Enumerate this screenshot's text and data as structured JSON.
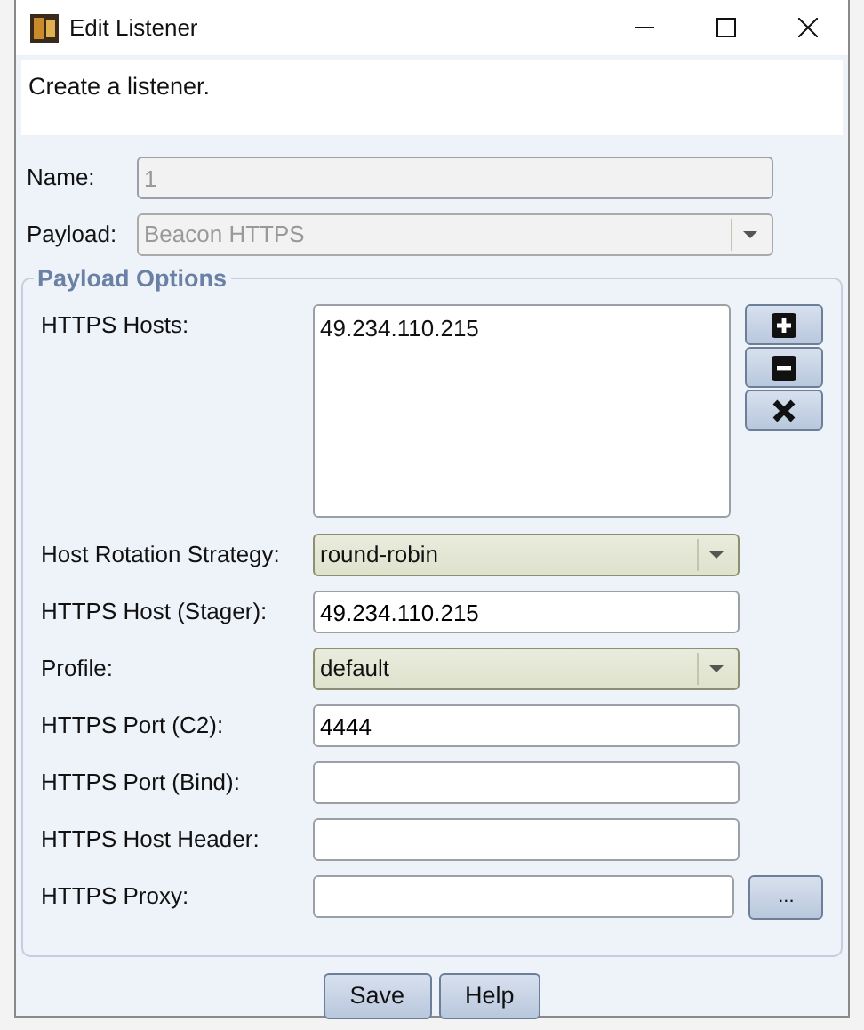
{
  "window": {
    "title": "Edit Listener"
  },
  "description": "Create a listener.",
  "top_fields": [
    {
      "label": "Name:",
      "kind": "text",
      "value": "1",
      "disabled": true
    },
    {
      "label": "Payload:",
      "kind": "select",
      "value": "Beacon HTTPS",
      "disabled": true
    }
  ],
  "payload_options": {
    "title": "Payload Options",
    "fields": [
      {
        "label": "HTTPS Hosts:",
        "kind": "textarea",
        "value": "49.234.110.215",
        "disabled": false
      },
      {
        "label": "Host Rotation Strategy:",
        "kind": "select",
        "value": "round-robin",
        "disabled": false
      },
      {
        "label": "HTTPS Host (Stager):",
        "kind": "text",
        "value": "49.234.110.215",
        "disabled": false
      },
      {
        "label": "Profile:",
        "kind": "select",
        "value": "default",
        "disabled": false
      },
      {
        "label": "HTTPS Port (C2):",
        "kind": "text",
        "value": "4444",
        "disabled": false
      },
      {
        "label": "HTTPS Port (Bind):",
        "kind": "text",
        "disabled": false
      },
      {
        "label": "HTTPS Host Header:",
        "kind": "text",
        "disabled": false
      },
      {
        "label": "HTTPS Proxy:",
        "kind": "proxy",
        "button": "...",
        "disabled": false
      }
    ]
  },
  "buttons": [
    "Save",
    "Help"
  ]
}
